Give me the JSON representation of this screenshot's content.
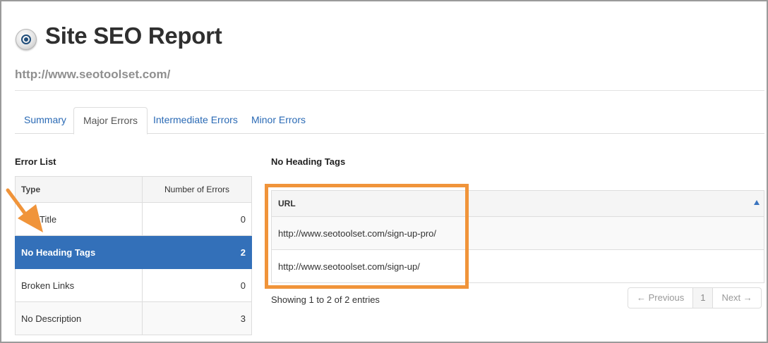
{
  "header": {
    "title": "Site SEO Report",
    "url": "http://www.seotoolset.com/"
  },
  "tabs": [
    {
      "label": "Summary",
      "active": false
    },
    {
      "label": "Major Errors",
      "active": true
    },
    {
      "label": "Intermediate Errors",
      "active": false
    },
    {
      "label": "Minor Errors",
      "active": false
    }
  ],
  "error_list": {
    "heading": "Error List",
    "columns": [
      "Type",
      "Number of Errors"
    ],
    "rows": [
      {
        "type": "Title",
        "count": "0",
        "selected": false
      },
      {
        "type": "No Heading Tags",
        "count": "2",
        "selected": true
      },
      {
        "type": "Broken Links",
        "count": "0",
        "selected": false
      },
      {
        "type": "No Description",
        "count": "3",
        "selected": false
      }
    ]
  },
  "detail": {
    "heading": "No Heading Tags",
    "column": "URL",
    "rows": [
      "http://www.seotoolset.com/sign-up-pro/",
      "http://www.seotoolset.com/sign-up/"
    ],
    "info": "Showing 1 to 2 of 2 entries",
    "pager": {
      "previous": "← Previous",
      "page": "1",
      "next": "Next →"
    }
  },
  "colors": {
    "accent_blue": "#3370b9",
    "link_blue": "#2a6ab5",
    "highlight_orange": "#f0943a"
  },
  "icons": {
    "title": "target-icon",
    "sort": "sort-ascending-icon",
    "annotation": "arrow-icon"
  }
}
